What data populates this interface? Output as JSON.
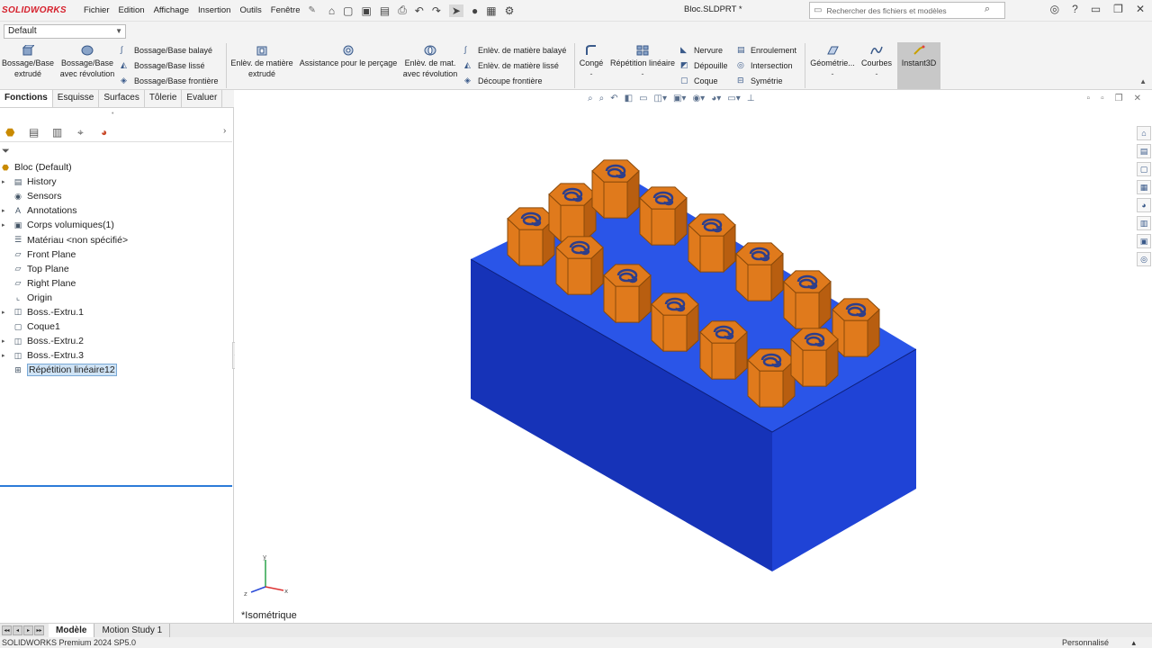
{
  "app": {
    "logo": "SOLIDWORKS",
    "menu": [
      "Fichier",
      "Edition",
      "Affichage",
      "Insertion",
      "Outils",
      "Fenêtre"
    ],
    "document_title": "Bloc.SLDPRT *",
    "search_placeholder": "Rechercher des fichiers et modèles",
    "configuration": "Default"
  },
  "ribbon": {
    "boss_extrude": "Bossage/Base extrudé",
    "boss_revolve": "Bossage/Base avec révolution",
    "boss_sweep": "Bossage/Base balayé",
    "boss_loft": "Bossage/Base lissé",
    "boss_boundary": "Bossage/Base frontière",
    "cut_extrude": "Enlèv. de matière extrudé",
    "hole_wizard": "Assistance pour le perçage",
    "cut_revolve": "Enlèv. de mat. avec révolution",
    "cut_sweep": "Enlèv. de matière balayé",
    "cut_loft": "Enlèv. de matière lissé",
    "cut_boundary": "Découpe frontière",
    "fillet": "Congé",
    "linear_pattern": "Répétition linéaire",
    "rib": "Nervure",
    "draft": "Dépouille",
    "shell": "Coque",
    "wrap": "Enroulement",
    "intersect": "Intersection",
    "mirror": "Symétrie",
    "ref_geometry": "Géométrie...",
    "curves": "Courbes",
    "instant3d": "Instant3D",
    "dash": "-"
  },
  "tabs": [
    "Fonctions",
    "Esquisse",
    "Surfaces",
    "Tôlerie",
    "Evaluer"
  ],
  "tree": [
    {
      "label": "Bloc (Default)",
      "icon": "part-icon",
      "expand": false,
      "root": true
    },
    {
      "label": "History",
      "icon": "folder-icon",
      "expand": true
    },
    {
      "label": "Sensors",
      "icon": "sensor-icon",
      "expand": false
    },
    {
      "label": "Annotations",
      "icon": "annotation-icon",
      "expand": true
    },
    {
      "label": "Corps volumiques(1)",
      "icon": "solid-bodies-icon",
      "expand": true
    },
    {
      "label": "Matériau <non spécifié>",
      "icon": "material-icon",
      "expand": false
    },
    {
      "label": "Front Plane",
      "icon": "plane-icon",
      "expand": false
    },
    {
      "label": "Top Plane",
      "icon": "plane-icon",
      "expand": false
    },
    {
      "label": "Right Plane",
      "icon": "plane-icon",
      "expand": false
    },
    {
      "label": "Origin",
      "icon": "origin-icon",
      "expand": false
    },
    {
      "label": "Boss.-Extru.1",
      "icon": "extrude-icon",
      "expand": true
    },
    {
      "label": "Coque1",
      "icon": "shell-icon",
      "expand": false
    },
    {
      "label": "Boss.-Extru.2",
      "icon": "extrude-icon",
      "expand": true
    },
    {
      "label": "Boss.-Extru.3",
      "icon": "extrude-icon",
      "expand": true
    },
    {
      "label": "Répétition linéaire12",
      "icon": "linear-pattern-icon",
      "expand": false,
      "selected": true
    }
  ],
  "viewport": {
    "view_name": "*Isométrique",
    "triad": {
      "x": "x",
      "y": "y",
      "z": "z"
    },
    "colors": {
      "block": "#1f43d6",
      "block_top": "#2a55e8",
      "block_front": "#1633b8",
      "pegs": "#e07a1c",
      "peg_dark": "#b85e10",
      "spiral": "#2e3e8a"
    }
  },
  "bottom_tabs": [
    "Modèle",
    "Motion Study 1"
  ],
  "status": {
    "product": "SOLIDWORKS Premium 2024 SP5.0",
    "mode": "Personnalisé"
  }
}
